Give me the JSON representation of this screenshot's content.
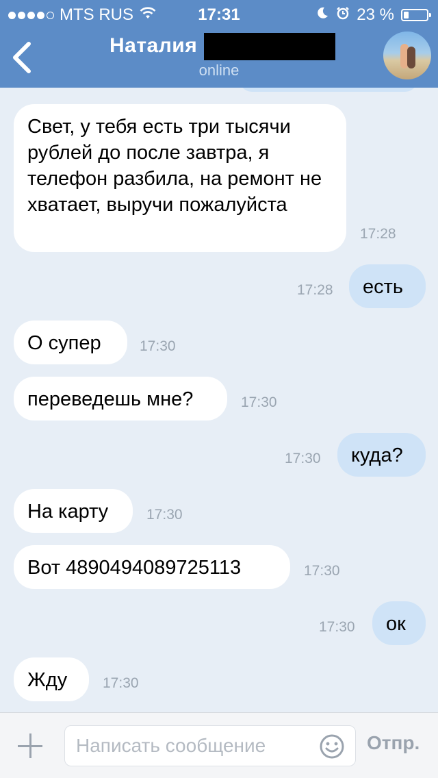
{
  "status_bar": {
    "carrier": "MTS RUS",
    "time": "17:31",
    "battery_percent": "23 %",
    "battery_level": 0.23,
    "signal_bars_filled": 4,
    "signal_bars_total": 5
  },
  "header": {
    "contact_name": "Наталия",
    "status": "online"
  },
  "messages": [
    {
      "direction": "in",
      "text": "Свет, у тебя есть три тысячи рублей до после завтра, я телефон разбила, на ремонт не хватает, выручи пожалуйста",
      "time": "17:28"
    },
    {
      "direction": "out",
      "text": "есть",
      "time": "17:28"
    },
    {
      "direction": "in",
      "text": "О супер",
      "time": "17:30"
    },
    {
      "direction": "in",
      "text": "переведешь мне?",
      "time": "17:30"
    },
    {
      "direction": "out",
      "text": "куда?",
      "time": "17:30"
    },
    {
      "direction": "in",
      "text": "На карту",
      "time": "17:30"
    },
    {
      "direction": "in",
      "text": "Вот 4890494089725113",
      "time": "17:30"
    },
    {
      "direction": "out",
      "text": "ок",
      "time": "17:30"
    },
    {
      "direction": "in",
      "text": "Жду",
      "time": "17:30"
    }
  ],
  "composer": {
    "placeholder": "Написать сообщение",
    "value": "",
    "send_label": "Отпр."
  },
  "colors": {
    "header_bg": "#5c8cc7",
    "chat_bg": "#e7eef6",
    "incoming_bubble": "#ffffff",
    "outgoing_bubble": "#cfe3f7",
    "timestamp": "#9aa5b1"
  },
  "icons": {
    "back": "chevron-left-icon",
    "wifi": "wifi-icon",
    "moon": "moon-icon",
    "alarm": "alarm-icon",
    "battery": "battery-icon",
    "attach": "plus-icon",
    "emoji": "smiley-icon"
  }
}
